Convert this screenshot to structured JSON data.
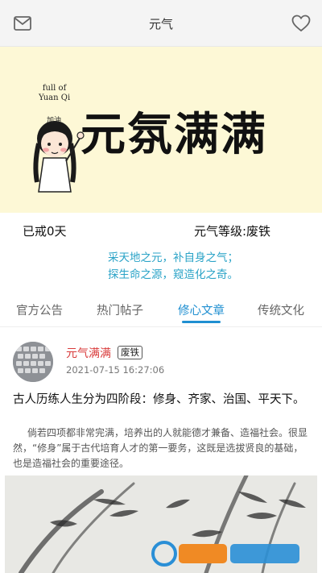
{
  "header": {
    "title": "元气",
    "left_icon": "mail-icon",
    "right_icon": "heart-icon"
  },
  "banner": {
    "small_text_line1": "full of",
    "small_text_line2": "Yuan Qi",
    "big_text": "元氛满满"
  },
  "stats": {
    "abstinence": "已戒0天",
    "level": "元气等级:废铁"
  },
  "slogan": {
    "line1": "采天地之元，补自身之气；",
    "line2": "探生命之源，窥造化之奇。"
  },
  "tabs": [
    {
      "label": "官方公告",
      "active": false
    },
    {
      "label": "热门帖子",
      "active": false
    },
    {
      "label": "修心文章",
      "active": true
    },
    {
      "label": "传统文化",
      "active": false
    }
  ],
  "post": {
    "author": "元气满满",
    "badge": "废铁",
    "time": "2021-07-15 16:27:06",
    "title": "古人历练人生分为四阶段：修身、齐家、治国、平天下。",
    "body": "倘若四项都非常完满，培养出的人就能德才兼备、造福社会。很显然，“修身”属于古代培育人才的第一要务，这既是选拔贤良的基础，也是造福社会的重要途径。"
  },
  "colors": {
    "accent": "#1f8fd1",
    "slogan": "#2aa3c7",
    "author": "#d93a3a",
    "banner_bg": "#fdf8d6"
  }
}
